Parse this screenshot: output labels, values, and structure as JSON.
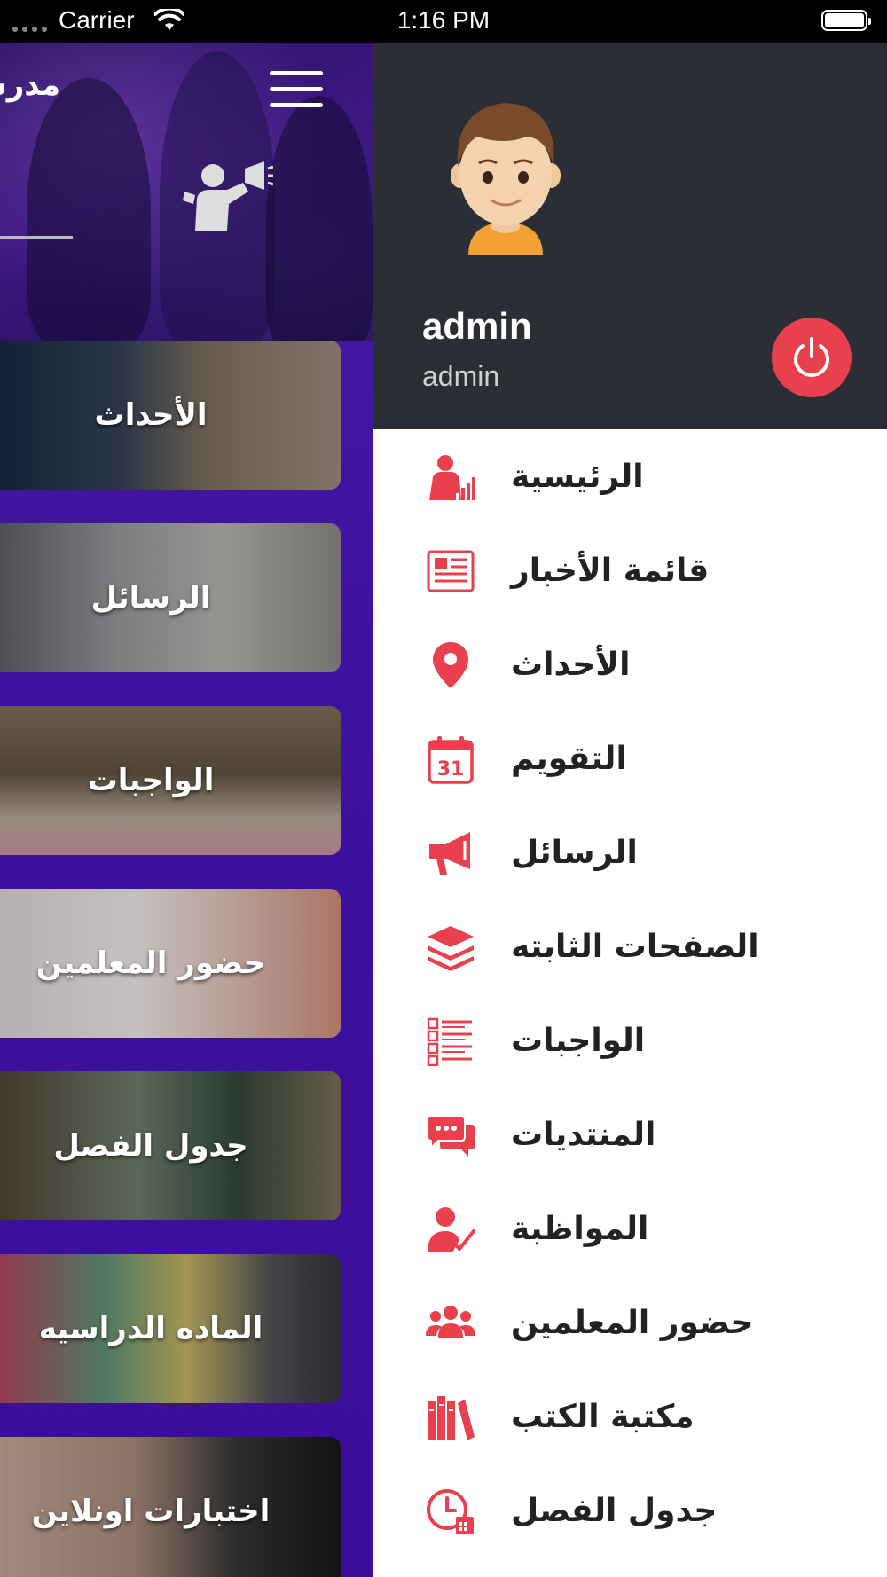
{
  "status_bar": {
    "carrier": "Carrier",
    "time": "1:16 PM"
  },
  "main": {
    "header_title": "مدرس",
    "tiles": [
      {
        "label": "الأحداث"
      },
      {
        "label": "الرسائل"
      },
      {
        "label": "الواجبات"
      },
      {
        "label": "حضور المعلمين"
      },
      {
        "label": "جدول الفصل"
      },
      {
        "label": "الماده الدراسيه"
      },
      {
        "label": "اختبارات اونلاين"
      }
    ]
  },
  "drawer": {
    "user_name": "admin",
    "user_role": "admin",
    "accent_color": "#e8414d",
    "menu": [
      {
        "label": "الرئيسية",
        "icon": "teacher-chart-icon"
      },
      {
        "label": "قائمة الأخبار",
        "icon": "newspaper-icon"
      },
      {
        "label": "الأحداث",
        "icon": "map-pin-icon"
      },
      {
        "label": "التقويم",
        "icon": "calendar-icon"
      },
      {
        "label": "الرسائل",
        "icon": "megaphone-icon"
      },
      {
        "label": "الصفحات الثابته",
        "icon": "layers-icon"
      },
      {
        "label": "الواجبات",
        "icon": "list-icon"
      },
      {
        "label": "المنتديات",
        "icon": "chat-icon"
      },
      {
        "label": "المواظبة",
        "icon": "user-check-icon"
      },
      {
        "label": "حضور المعلمين",
        "icon": "users-icon"
      },
      {
        "label": "مكتبة الكتب",
        "icon": "books-icon"
      },
      {
        "label": "جدول الفصل",
        "icon": "clock-calendar-icon"
      }
    ]
  }
}
